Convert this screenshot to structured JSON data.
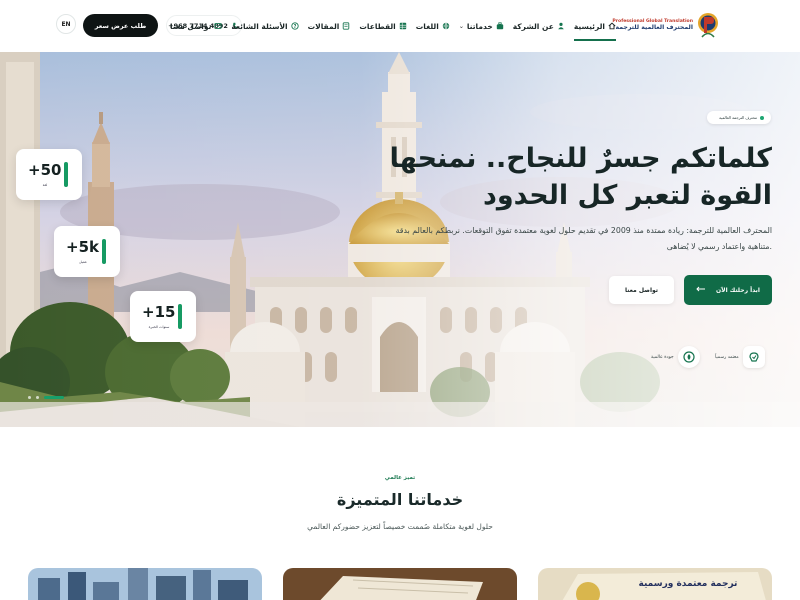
{
  "nav": {
    "lang": "EN",
    "quote_button": "طلب عرض سعر",
    "phone": "+968 7714 4092",
    "menu": [
      {
        "label": "الرئيسية",
        "icon": "home-icon"
      },
      {
        "label": "عن الشركة",
        "icon": "people-icon"
      },
      {
        "label": "خدماتنا",
        "icon": "services-icon"
      },
      {
        "label": "اللغات",
        "icon": "globe-icon"
      },
      {
        "label": "القطاعات",
        "icon": "grid-icon"
      },
      {
        "label": "المقالات",
        "icon": "article-icon"
      },
      {
        "label": "الأسئلة الشائعة",
        "icon": "question-icon"
      },
      {
        "label": "تواصل معنا",
        "icon": "mail-icon"
      }
    ],
    "logo": {
      "en": "Professional Global Translation",
      "ar": "المحترف العالمية للترجمة"
    }
  },
  "hero": {
    "badge": "محترف الترجمة العالمية",
    "headline_line1": "كلماتكم جسرٌ للنجاح.. نمنحها",
    "headline_line2": "القوة لتعبر كل الحدود",
    "description": "المحترف العالمية للترجمة: ريادة ممتدة منذ 2009 في تقديم حلول لغوية معتمدة تفوق التوقعات. نربطكم بالعالم بدقة متناهية واعتماد رسمي لا يُضاهى.",
    "cta_primary": "ابدأ رحلتك الآن",
    "cta_secondary": "تواصل معنا",
    "trust": [
      {
        "label": "معتمد رسمياً",
        "icon": "certified-icon"
      },
      {
        "label": "جودة عالمية",
        "icon": "quality-icon"
      }
    ],
    "stats": [
      {
        "value": "+50",
        "label": "لغة"
      },
      {
        "value": "+5k",
        "label": "عميل"
      },
      {
        "value": "+15",
        "label": "سنوات الخبرة"
      }
    ]
  },
  "services": {
    "kicker": "تميز عالمي",
    "title": "خدماتنا المتميزة",
    "subtitle": "حلول لغوية متكاملة صُممت خصيصاً لتعزيز حضوركم العالمي",
    "cards": [
      {
        "label": "ترجمة معتمدة ورسمية"
      },
      {
        "label": ""
      },
      {
        "label": ""
      }
    ]
  },
  "colors": {
    "accent": "#106b47",
    "dark": "#0e1414",
    "bar": "#169a63"
  }
}
